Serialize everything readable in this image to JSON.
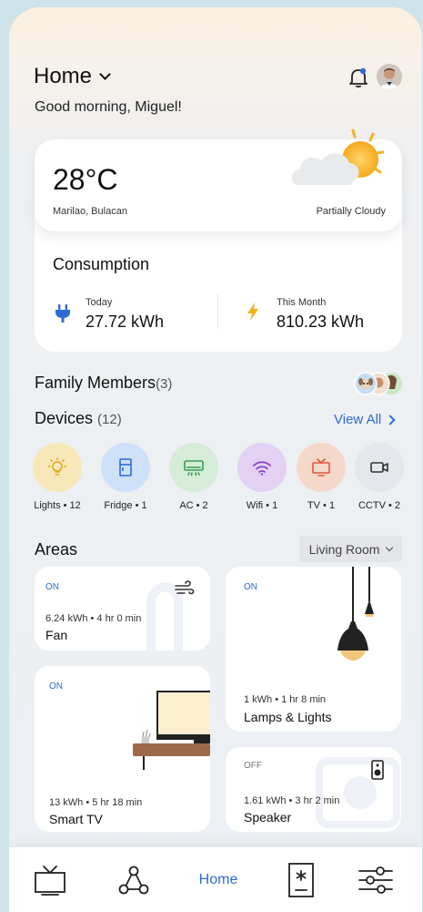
{
  "header": {
    "title": "Home",
    "greeting": "Good morning, Miguel!"
  },
  "weather": {
    "temperature": "28°C",
    "location": "Marilao, Bulacan",
    "condition": "Partially Cloudy"
  },
  "consumption": {
    "title": "Consumption",
    "today_label": "Today",
    "today_value": "27.72 kWh",
    "month_label": "This Month",
    "month_value": "810.23 kWh"
  },
  "family": {
    "title": "Family Members",
    "count": "(3)"
  },
  "devices": {
    "title": "Devices",
    "count": "(12)",
    "view_all": "View All",
    "items": [
      {
        "label": "Lights • 12",
        "icon": "lightbulb-icon",
        "bg": "#f8e7b9",
        "color": "#e0a81c"
      },
      {
        "label": "Fridge • 1",
        "icon": "fridge-icon",
        "bg": "#cfe0f9",
        "color": "#2d6bd3"
      },
      {
        "label": "AC • 2",
        "icon": "ac-icon",
        "bg": "#d4ecd8",
        "color": "#3a9b54"
      },
      {
        "label": "Wifi • 1",
        "icon": "wifi-icon",
        "bg": "#e3d1f4",
        "color": "#8a45c9"
      },
      {
        "label": "TV • 1",
        "icon": "tv-icon",
        "bg": "#f6d8cb",
        "color": "#e0593a"
      },
      {
        "label": "CCTV • 2",
        "icon": "cctv-icon",
        "bg": "#e4e7ec",
        "color": "#333333"
      }
    ]
  },
  "areas": {
    "title": "Areas",
    "room": "Living Room",
    "cards": [
      {
        "status": "ON",
        "stats": "6.24 kWh • 4 hr 0 min",
        "name": "Fan"
      },
      {
        "status": "ON",
        "stats": "1 kWh • 1 hr 8 min",
        "name": "Lamps & Lights"
      },
      {
        "status": "ON",
        "stats": "13 kWh • 5 hr 18 min",
        "name": "Smart TV"
      },
      {
        "status": "OFF",
        "stats": "1.61 kWh • 3 hr 2 min",
        "name": "Speaker"
      }
    ]
  },
  "nav": {
    "home_label": "Home"
  },
  "colors": {
    "accent": "#2d6bd3",
    "plug": "#2d6bd3",
    "bolt": "#f2b01e"
  }
}
